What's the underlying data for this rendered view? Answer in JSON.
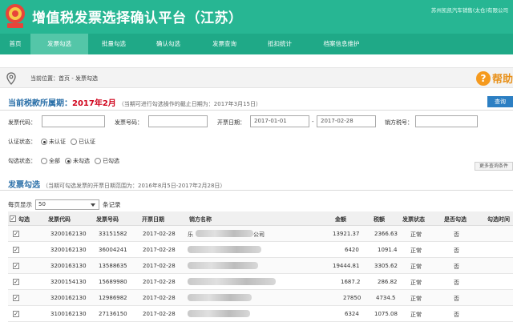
{
  "header": {
    "title": "增值税发票选择确认平台（江苏）",
    "company": "苏州凯凯汽车销售(太仓)有限公司"
  },
  "nav": [
    {
      "label": "首页"
    },
    {
      "label": "发票勾选",
      "active": true
    },
    {
      "label": "批量勾选"
    },
    {
      "label": "确认勾选"
    },
    {
      "label": "发票查询"
    },
    {
      "label": "抵扣统计"
    },
    {
      "label": "档案信息维护"
    }
  ],
  "breadcrumb": {
    "text": "当前位置：首页 - 发票勾选"
  },
  "help": {
    "icon_char": "?",
    "label": "帮助"
  },
  "period": {
    "label": "当前税款所属期：",
    "value": "2017年2月",
    "note": "（当期可进行勾选操作的截止日期为：2017年3月15日）"
  },
  "query_button": "查询",
  "form": {
    "invoice_code_label": "发票代码：",
    "invoice_number_label": "发票号码：",
    "date_label": "开票日期：",
    "date_from": "2017-01-01",
    "date_sep": "-",
    "date_to": "2017-02-28",
    "seller_tax_label": "销方税号：",
    "cert_status_label": "认证状态：",
    "cert_options": [
      "未认证",
      "已认证"
    ],
    "select_status_label": "勾选状态：",
    "select_options": [
      "全部",
      "未勾选",
      "已勾选"
    ],
    "more_button": "更多查询条件"
  },
  "section": {
    "title": "发票勾选",
    "note": "（当期可勾选发票的开票日期范围为：2016年8月5日-2017年2月28日）"
  },
  "pagination": {
    "prefix": "每页显示",
    "value": "50",
    "suffix": "条记录"
  },
  "table": {
    "headers": {
      "check": "勾选",
      "code": "发票代码",
      "number": "发票号码",
      "date": "开票日期",
      "seller": "销方名称",
      "amount": "金额",
      "tax": "税额",
      "status": "发票状态",
      "selected": "是否勾选",
      "time": "勾选时间"
    },
    "rows": [
      {
        "code": "3200162130",
        "number": "33151582",
        "date": "2017-02-28",
        "seller": "乐",
        "seller_tail": "公司",
        "amount": "13921.37",
        "tax": "2366.63",
        "status": "正常",
        "selected": "否"
      },
      {
        "code": "3200162130",
        "number": "36004241",
        "date": "2017-02-28",
        "seller": "",
        "seller_tail": "",
        "amount": "6420",
        "tax": "1091.4",
        "status": "正常",
        "selected": "否"
      },
      {
        "code": "3200163130",
        "number": "13588635",
        "date": "2017-02-28",
        "seller": "",
        "seller_tail": "",
        "amount": "19444.81",
        "tax": "3305.62",
        "status": "正常",
        "selected": "否"
      },
      {
        "code": "3200154130",
        "number": "15689980",
        "date": "2017-02-28",
        "seller": "",
        "seller_tail": "",
        "amount": "1687.2",
        "tax": "286.82",
        "status": "正常",
        "selected": "否"
      },
      {
        "code": "3200162130",
        "number": "12986982",
        "date": "2017-02-28",
        "seller": "",
        "seller_tail": "",
        "amount": "27850",
        "tax": "4734.5",
        "status": "正常",
        "selected": "否"
      },
      {
        "code": "3100162130",
        "number": "27136150",
        "date": "2017-02-28",
        "seller": "",
        "seller_tail": "",
        "amount": "6324",
        "tax": "1075.08",
        "status": "正常",
        "selected": "否"
      }
    ]
  },
  "colors": {
    "header_bg": "#27b693",
    "nav_bg": "#1fa987",
    "nav_active": "#54c6a8",
    "accent_blue": "#2a6fa8",
    "period_red": "#d0021b",
    "help_orange": "#f59a1e"
  }
}
